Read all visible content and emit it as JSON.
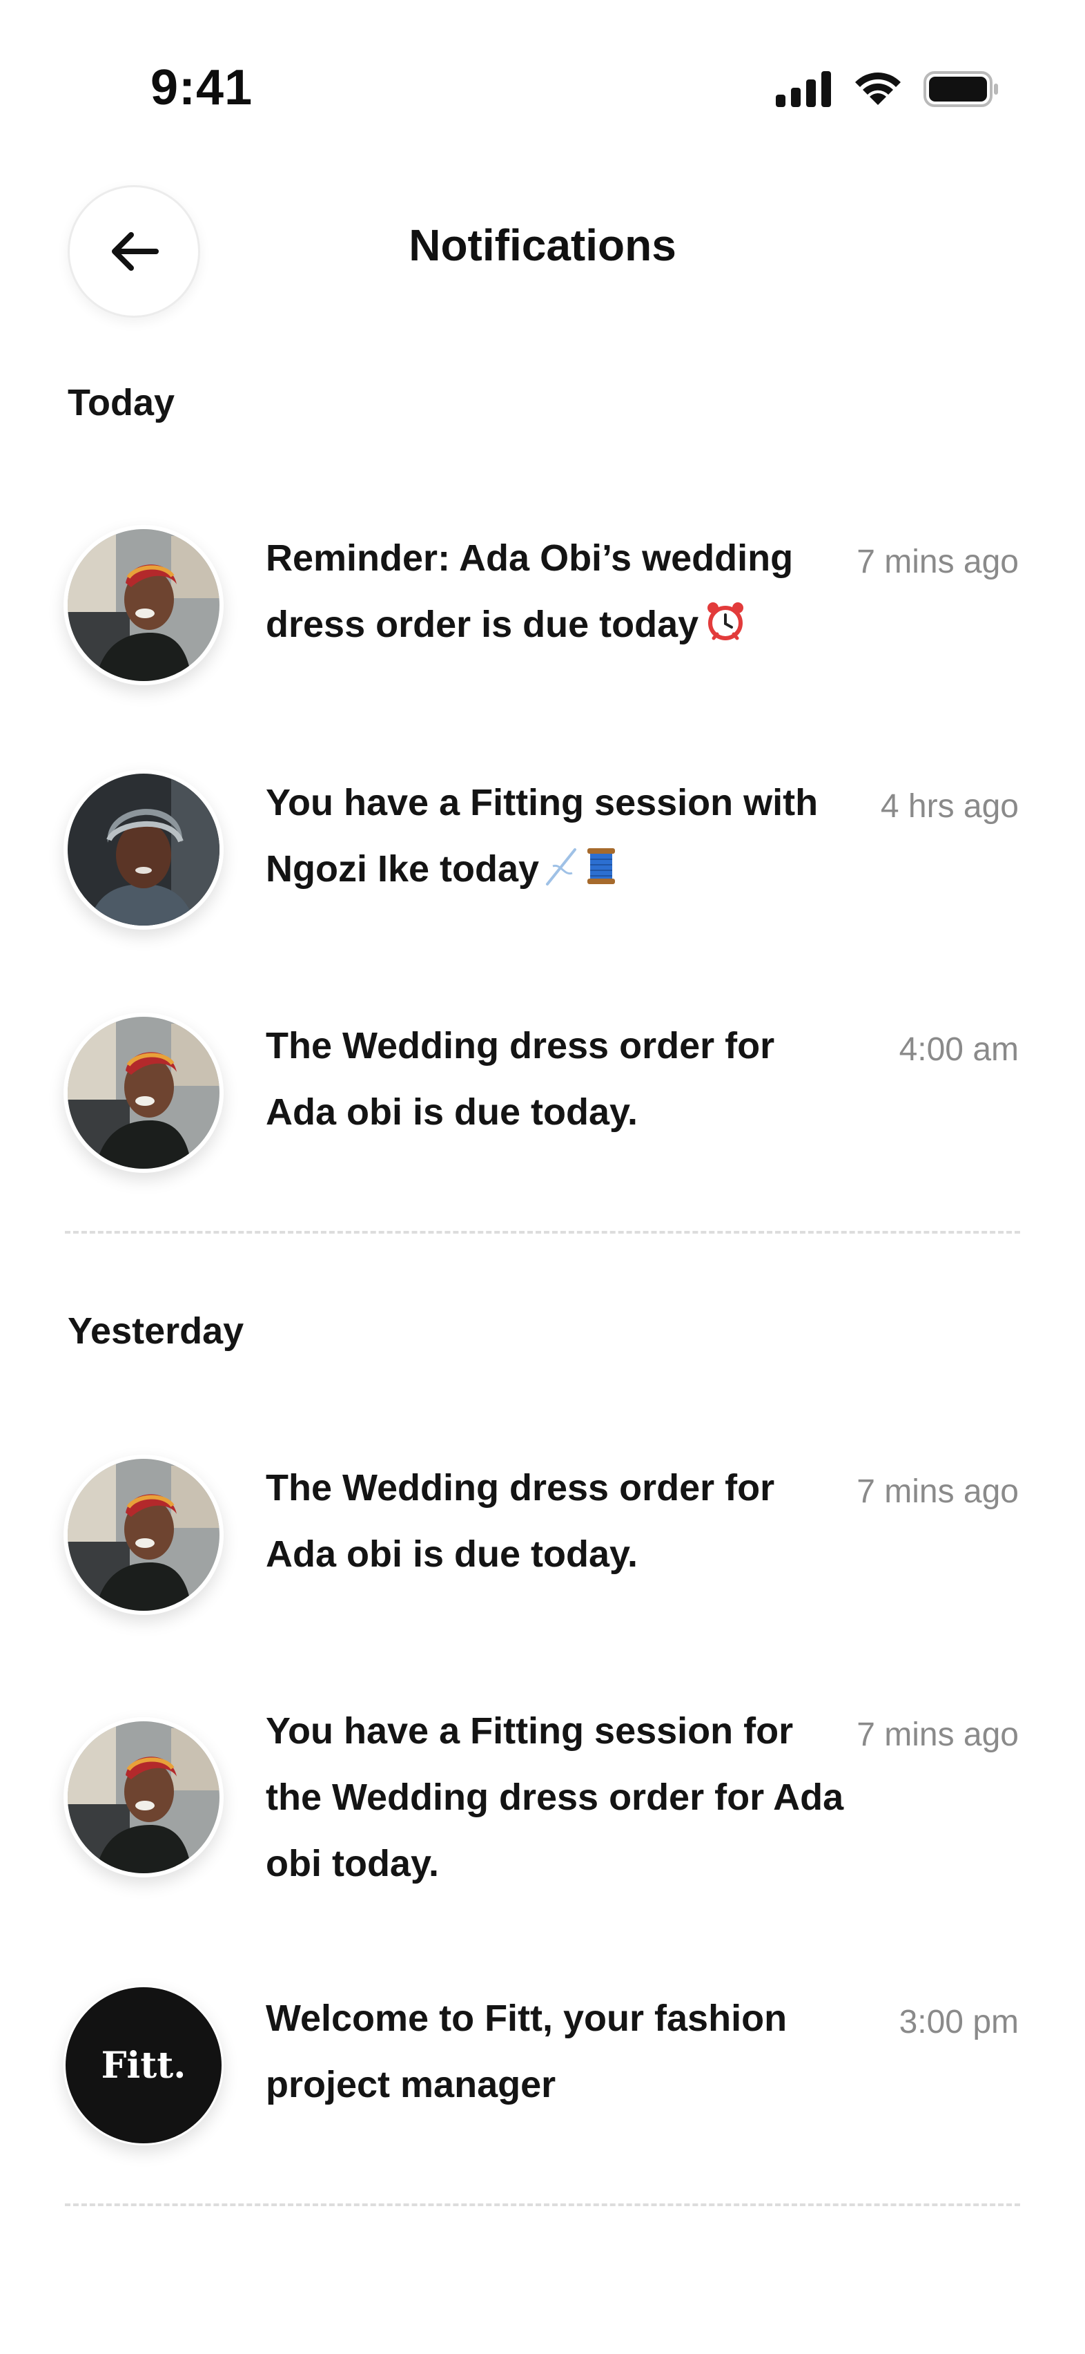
{
  "status_bar": {
    "time": "9:41",
    "icons": [
      "signal-icon",
      "wifi-icon",
      "battery-icon"
    ]
  },
  "header": {
    "back_icon": "arrow-left-icon",
    "title": "Notifications"
  },
  "sections": [
    {
      "title": "Today",
      "items": [
        {
          "avatar": "woman-headwrap-photo",
          "message": "Reminder: Ada Obi’s wedding dress order is due today",
          "emoji": "alarm-clock-icon",
          "time": "7 mins ago"
        },
        {
          "avatar": "woman-gray-headwrap-photo",
          "message": "You have a Fitting session with Ngozi Ike today",
          "emoji": "needle-thread-icon",
          "time": "4 hrs ago"
        },
        {
          "avatar": "woman-headwrap-photo",
          "message": "The Wedding dress order for Ada obi is due today.",
          "time": "4:00 am"
        }
      ]
    },
    {
      "title": "Yesterday",
      "items": [
        {
          "avatar": "woman-headwrap-photo",
          "message": "The Wedding dress order for Ada obi is due today.",
          "time": "7 mins ago"
        },
        {
          "avatar": "woman-headwrap-photo",
          "message": "You have a Fitting session for the Wedding dress order for Ada obi today.",
          "time": "7 mins ago"
        },
        {
          "avatar": "fitt-logo",
          "avatar_text": "Fitt.",
          "message": "Welcome to Fitt, your fashion project manager",
          "time": "3:00 pm"
        }
      ]
    }
  ],
  "colors": {
    "text": "#141414",
    "muted": "#8a8a8a",
    "divider": "#dddddd",
    "logo_bg": "#121212"
  }
}
